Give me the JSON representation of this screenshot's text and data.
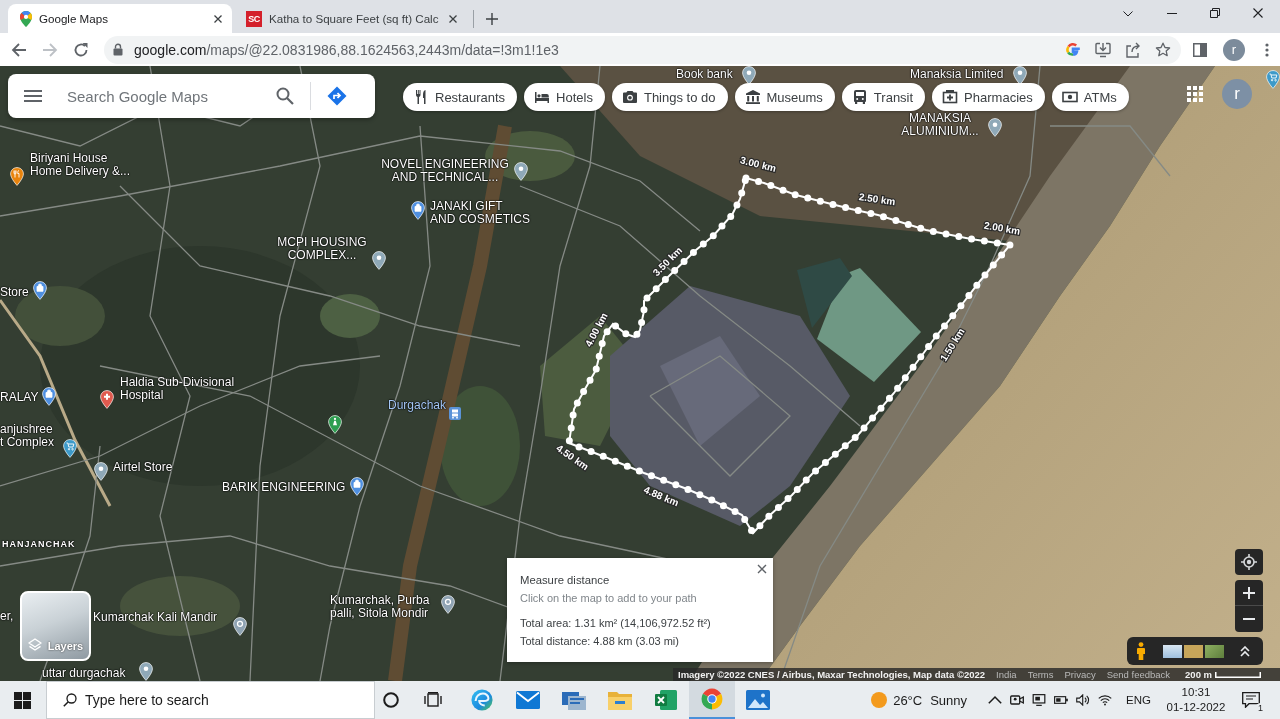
{
  "browser": {
    "tabs": [
      {
        "title": "Google Maps",
        "kind": "maps",
        "selected": true
      },
      {
        "title": "Katha to Square Feet (sq ft) Calc",
        "kind": "letters",
        "favicon_text": "SC",
        "selected": false
      }
    ],
    "nav_buttons": [
      {
        "kind": "back",
        "disabled": false
      },
      {
        "kind": "forward",
        "disabled": true
      },
      {
        "kind": "reload",
        "disabled": false
      }
    ],
    "url": {
      "host": "google.com",
      "path": "/maps/@22.0831986,88.1624563,2443m/data=!3m1!1e3"
    },
    "profile_initial": "r"
  },
  "maps": {
    "search": {
      "placeholder": "Search Google Maps"
    },
    "chips": [
      {
        "label": "Restaurants",
        "kind": "restaurants",
        "selected": false
      },
      {
        "label": "Hotels",
        "kind": "hotels",
        "selected": false
      },
      {
        "label": "Things to do",
        "kind": "things",
        "selected": false
      },
      {
        "label": "Museums",
        "kind": "museums",
        "selected": false
      },
      {
        "label": "Transit",
        "kind": "transit",
        "selected": false
      },
      {
        "label": "Pharmacies",
        "kind": "pharmacies",
        "selected": false
      },
      {
        "label": "ATMs",
        "kind": "atms",
        "selected": false
      }
    ],
    "account_initial": "r",
    "places": [
      {
        "lines": [
          "Book bank"
        ],
        "kind": "place"
      },
      {
        "lines": [
          "Manaksia Limited"
        ],
        "kind": "place"
      },
      {
        "kind": "cart"
      },
      {
        "lines": [
          "MANAKSIA",
          "ALUMINIUM..."
        ],
        "kind": "place"
      },
      {
        "lines": [
          "Biriyani House",
          "Home Delivery &..."
        ],
        "kind": "restaurant"
      },
      {
        "lines": [
          "NOVEL ENGINEERING",
          "AND TECHNICAL..."
        ],
        "kind": "place"
      },
      {
        "lines": [
          "JANAKI GIFT",
          "AND COSMETICS"
        ],
        "kind": "shopping"
      },
      {
        "lines": [
          "MCPI HOUSING",
          "COMPLEX..."
        ],
        "kind": "place"
      },
      {
        "lines": [
          "Store"
        ],
        "kind": "shopping"
      },
      {
        "lines": [
          "RALAY"
        ],
        "kind": "shopping"
      },
      {
        "lines": [
          "Haldia Sub-Divisional",
          "Hospital"
        ],
        "kind": "hospital"
      },
      {
        "lines": [
          "Durgachak"
        ],
        "kind": "transit"
      },
      {
        "lines": [
          "anjushree",
          "t Complex"
        ],
        "kind": "cart"
      },
      {
        "kind": "park"
      },
      {
        "lines": [
          "Airtel Store"
        ],
        "kind": "place"
      },
      {
        "lines": [
          "BARIK ENGINEERING"
        ],
        "kind": "shopping"
      },
      {
        "lines": [
          "HANJANCHAK"
        ],
        "kind": "area"
      },
      {
        "lines": [
          "er,"
        ],
        "kind": "text"
      },
      {
        "lines": [
          "Kumarchak Kali Mandir"
        ],
        "kind": "temple"
      },
      {
        "lines": [
          "Kumarchak, Purba",
          "palli, Sitola Mondir"
        ],
        "kind": "temple"
      },
      {
        "lines": [
          "uttar durgachak"
        ],
        "kind": "place"
      }
    ],
    "measure_path": {
      "distance_labels": [
        "3.00 km",
        "2.50 km",
        "2.00 km",
        "3.50 km",
        "4.00 km",
        "1.50 km",
        "4.50 km",
        "4.88 km"
      ]
    },
    "measure_panel": {
      "title": "Measure distance",
      "hint": "Click on the map to add to your path",
      "area": "Total area: 1.31 km² (14,106,972.52 ft²)",
      "distance": "Total distance: 4.88 km (3.03 mi)"
    },
    "layers_label": "Layers",
    "footer": [
      {
        "text": "Imagery ©2022 CNES / Airbus, Maxar Technologies, Map data ©2022",
        "kind": "credit"
      },
      {
        "text": "India",
        "kind": "link"
      },
      {
        "text": "Terms",
        "kind": "link"
      },
      {
        "text": "Privacy",
        "kind": "link"
      },
      {
        "text": "Send feedback",
        "kind": "link"
      }
    ],
    "scale": "200 m"
  },
  "taskbar": {
    "search_placeholder": "Type here to search",
    "apps": [
      {
        "kind": "cortana",
        "active": false
      },
      {
        "kind": "taskview",
        "active": false
      },
      {
        "kind": "edge",
        "active": false
      },
      {
        "kind": "mail",
        "active": false
      },
      {
        "kind": "remote",
        "active": false
      },
      {
        "kind": "explorer",
        "active": false
      },
      {
        "kind": "excel",
        "active": false
      },
      {
        "kind": "chrome",
        "active": true
      },
      {
        "kind": "photos",
        "active": false
      }
    ],
    "weather": {
      "temperature": "26°C",
      "condition": "Sunny"
    },
    "language": "ENG",
    "time": "10:31",
    "date": "01-12-2022",
    "notification_count": "1"
  }
}
